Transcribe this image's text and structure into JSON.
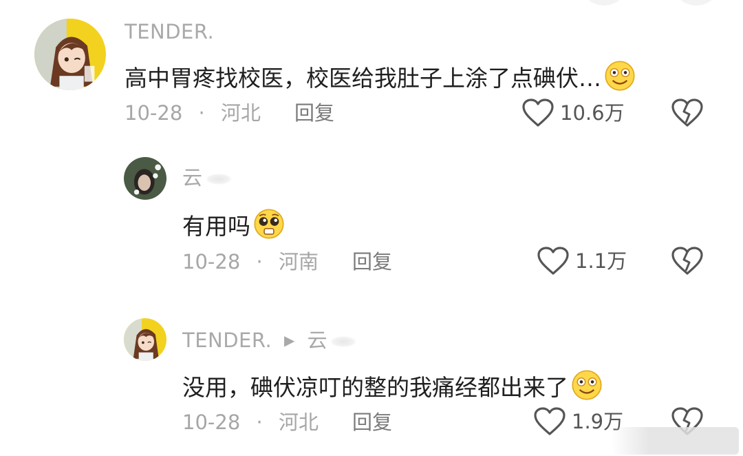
{
  "comments": [
    {
      "username": "TENDER.",
      "content": "高中胃疼找校医，校医给我肚子上涂了点碘伏…",
      "date": "10-28",
      "separator": "·",
      "location": "河北",
      "reply_label": "回复",
      "likes": "10.6万",
      "avatar_icon": "anime-girl-avatar",
      "emoji_icon": "grinning-emoji"
    },
    {
      "username": "云",
      "content": "有用吗",
      "date": "10-28",
      "separator": "·",
      "location": "河南",
      "reply_label": "回复",
      "likes": "1.1万",
      "avatar_icon": "person-photo-avatar",
      "emoji_icon": "pleading-emoji"
    },
    {
      "username": "TENDER.",
      "reply_to": "云",
      "reply_arrow": "▶",
      "content": "没用，碘伏凉叮的整的我痛经都出来了",
      "date": "10-28",
      "separator": "·",
      "location": "河北",
      "reply_label": "回复",
      "likes": "1.9万",
      "avatar_icon": "anime-girl-avatar",
      "emoji_icon": "grinning-emoji"
    }
  ],
  "colors": {
    "text_primary": "#1f1f1f",
    "text_secondary": "#a6a6a6",
    "avatar_yellow": "#f2d21e"
  }
}
